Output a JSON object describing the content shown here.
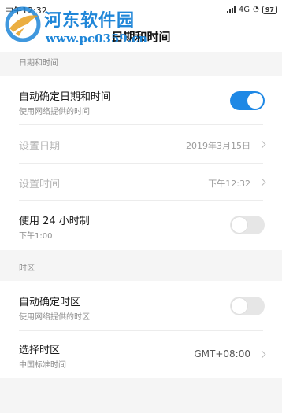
{
  "status_bar": {
    "time": "中午12:32",
    "network": "4G",
    "battery": "97"
  },
  "header": {
    "title": "日期和时间"
  },
  "watermark": {
    "site_name": "河东软件园",
    "url": "www.pc0359.cn"
  },
  "sections": {
    "datetime": {
      "header": "日期和时间",
      "auto_datetime": {
        "title": "自动确定日期和时间",
        "subtitle": "使用网络提供的时间",
        "enabled": true
      },
      "set_date": {
        "title": "设置日期",
        "value": "2019年3月15日"
      },
      "set_time": {
        "title": "设置时间",
        "value": "下午12:32"
      },
      "hour24": {
        "title": "使用 24 小时制",
        "subtitle": "下午1:00",
        "enabled": false
      }
    },
    "timezone": {
      "header": "时区",
      "auto_timezone": {
        "title": "自动确定时区",
        "subtitle": "使用网络提供的时区",
        "enabled": false
      },
      "select_timezone": {
        "title": "选择时区",
        "subtitle": "中国标准时间",
        "value": "GMT+08:00"
      }
    }
  },
  "colors": {
    "accent": "#1e88e5",
    "watermark": "#1f86d8"
  }
}
